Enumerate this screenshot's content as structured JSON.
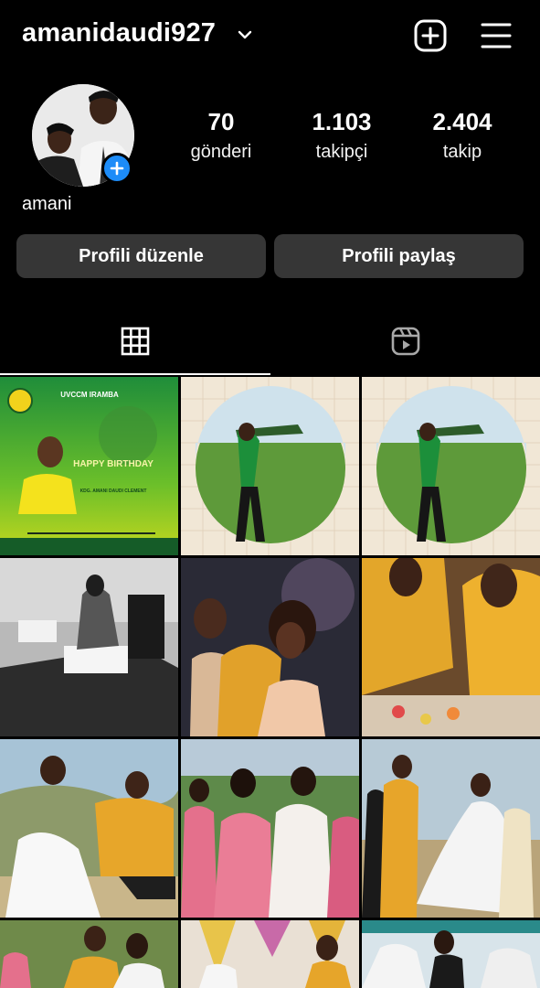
{
  "header": {
    "username": "amanidaudi927",
    "username_chevron_icon": "chevron-down-icon",
    "create_icon": "plus-square-icon",
    "menu_icon": "hamburger-menu-icon"
  },
  "profile": {
    "display_name": "amani",
    "stats": [
      {
        "value": "70",
        "label": "gönderi"
      },
      {
        "value": "1.103",
        "label": "takipçi"
      },
      {
        "value": "2.404",
        "label": "takip"
      }
    ],
    "edit_button": "Profili düzenle",
    "share_button": "Profili paylaş"
  },
  "tabs": [
    {
      "icon": "grid-icon",
      "selected": true
    },
    {
      "icon": "reels-icon",
      "selected": false
    }
  ],
  "posts": [
    {
      "id": 1,
      "title": "UVCCM IRAMBA",
      "headline": "HAPPY BIRTHDAY",
      "name": "KDG. AMANI DAUDI CLEMENT"
    },
    {
      "id": 2
    },
    {
      "id": 3
    },
    {
      "id": 4
    },
    {
      "id": 5
    },
    {
      "id": 6
    },
    {
      "id": 7
    },
    {
      "id": 8
    },
    {
      "id": 9
    },
    {
      "id": 10
    },
    {
      "id": 11
    },
    {
      "id": 12
    }
  ]
}
